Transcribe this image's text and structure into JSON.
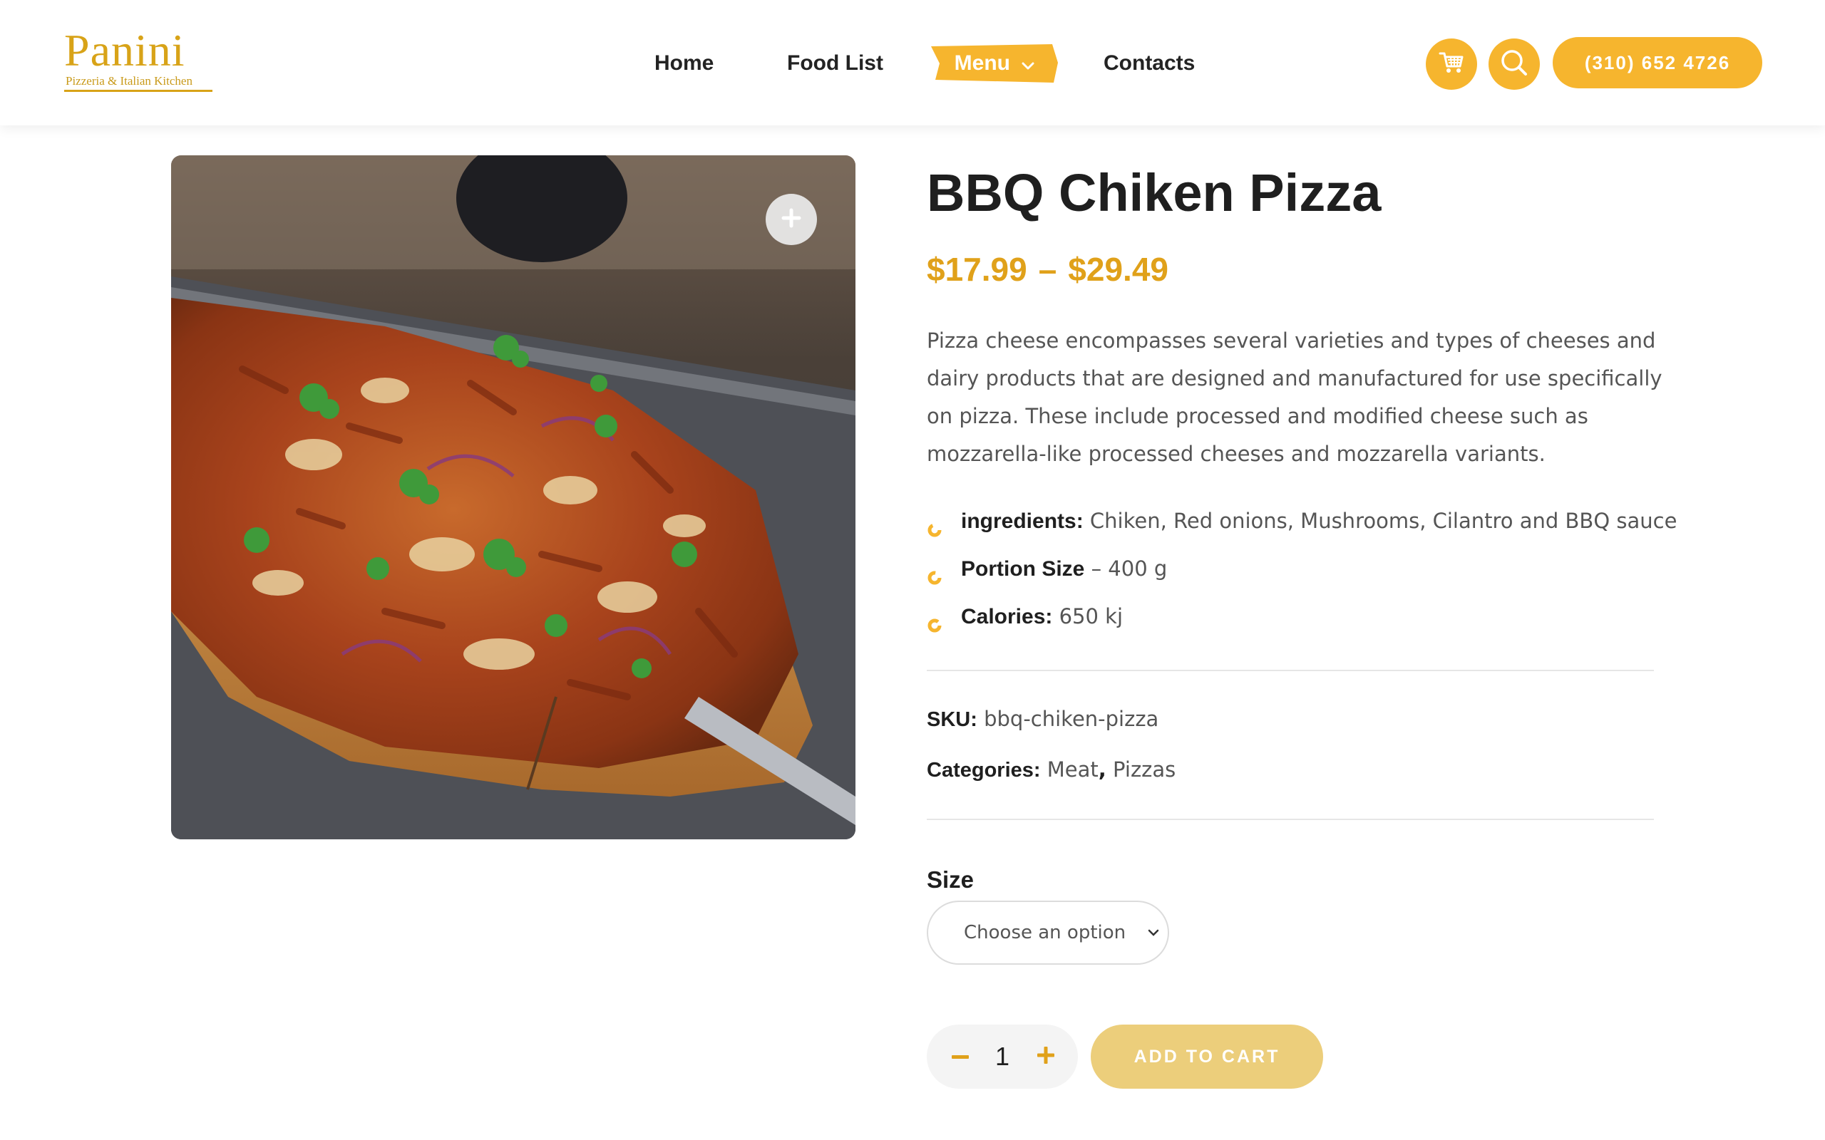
{
  "header": {
    "logo": {
      "title": "Panini",
      "subtitle": "Pizzeria & Italian Kitchen"
    },
    "nav": [
      {
        "label": "Home"
      },
      {
        "label": "Food List"
      },
      {
        "label": "Menu",
        "active": true
      },
      {
        "label": "Contacts"
      }
    ],
    "phone": "(310) 652 4726",
    "icons": {
      "cart": "cart-icon",
      "search": "search-icon",
      "menu_caret": "chevron-down-icon"
    }
  },
  "product": {
    "title": "BBQ Chiken Pizza",
    "price_min": "$17.99",
    "price_sep": "–",
    "price_max": "$29.49",
    "description": "Pizza cheese encompasses several varieties and types of cheeses and dairy products that are designed and manufactured for use specifically on pizza. These include processed and modified cheese such as mozzarella-like processed cheeses and mozzarella variants.",
    "specs": [
      {
        "label": "ingredients:",
        "value": "Chiken, Red onions, Mushrooms, Cilantro and BBQ sauce"
      },
      {
        "label": "Portion Size",
        "value": "– 400 g"
      },
      {
        "label": "Calories:",
        "value": "650 kj"
      }
    ],
    "sku_label": "SKU:",
    "sku": "bbq-chiken-pizza",
    "categories_label": "Categories:",
    "categories": [
      "Meat",
      "Pizzas"
    ],
    "size_label": "Size",
    "size_placeholder": "Choose an option",
    "quantity": "1",
    "add_to_cart": "ADD TO CART",
    "image": "bbq-chicken-pizza-photo"
  },
  "colors": {
    "accent": "#f6b52e",
    "price": "#e0a11a",
    "logo": "#d8a318",
    "add_to_cart_bg": "#ecce7b"
  }
}
